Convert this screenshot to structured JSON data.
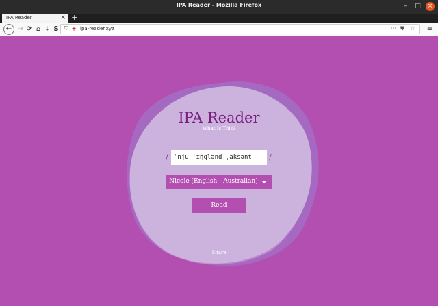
{
  "window": {
    "title": "IPA Reader - Mozilla Firefox"
  },
  "tab": {
    "label": "IPA Reader",
    "close": "×",
    "new_tab": "+"
  },
  "toolbar": {
    "url": "ipa-reader.xyz"
  },
  "app": {
    "title": "IPA Reader",
    "what_is_this": "What Is This?",
    "slash_left": "/",
    "slash_right": "/",
    "ipa_value": "ˈnju ˈɪŋɡlənd ˌaksənt",
    "voice_selected": "Nicole [English - Australian]",
    "read_label": "Read",
    "share_label": "Share"
  },
  "colors": {
    "background": "#b34fb1",
    "title": "#7a1f82",
    "blob": "#cbb3de"
  }
}
